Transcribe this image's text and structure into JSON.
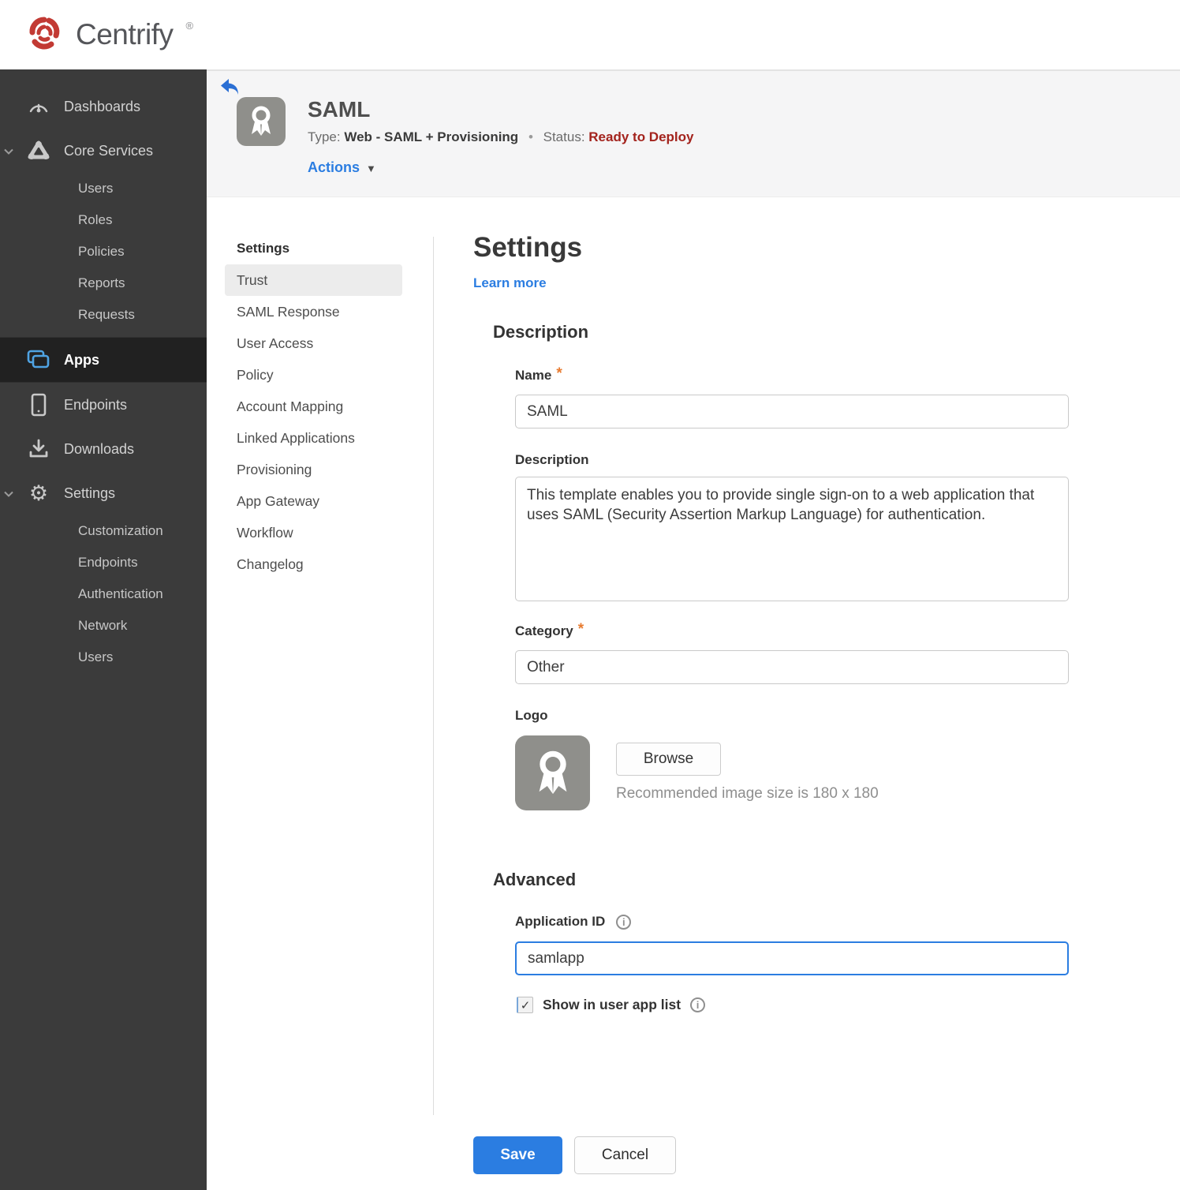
{
  "colors": {
    "accent_blue": "#2b7de1",
    "status_red": "#a3231d",
    "required_orange": "#e87b30",
    "brand_red": "#c23a34",
    "sidebar_bg": "#3b3b3b",
    "selected_row_bg": "#212121",
    "header_bg": "#f5f5f6"
  },
  "icons": {
    "brand": "centrify-swirl-icon",
    "dashboards": "gauge-icon",
    "core_services": "cluster-icon",
    "apps": "overlapping-windows-icon",
    "endpoints": "mobile-device-icon",
    "downloads": "download-icon",
    "settings": "gear-icon",
    "back": "back-arrow-icon",
    "app_logo": "award-ribbon-icon",
    "info": "info-circle-icon",
    "caret": "chevron-down-icon"
  },
  "topbar": {
    "brand": "Centrify",
    "brand_mark": "®"
  },
  "sidebar": {
    "dashboards": "Dashboards",
    "core_services": "Core Services",
    "core_children": [
      "Users",
      "Roles",
      "Policies",
      "Reports",
      "Requests"
    ],
    "apps": "Apps",
    "endpoints": "Endpoints",
    "downloads": "Downloads",
    "settings": "Settings",
    "settings_children": [
      "Customization",
      "Endpoints",
      "Authentication",
      "Network",
      "Users"
    ],
    "selected": "Apps"
  },
  "app_header": {
    "title": "SAML",
    "type_label": "Type:",
    "type_value": "Web - SAML + Provisioning",
    "separator": "•",
    "status_label": "Status:",
    "status_value": "Ready to Deploy",
    "actions_label": "Actions",
    "actions_caret": "▼"
  },
  "subnav": {
    "header": "Settings",
    "items": [
      "Trust",
      "SAML Response",
      "User Access",
      "Policy",
      "Account Mapping",
      "Linked Applications",
      "Provisioning",
      "App Gateway",
      "Workflow",
      "Changelog"
    ],
    "selected": "Trust"
  },
  "form": {
    "title": "Settings",
    "learn_more": "Learn more",
    "description_section": "Description",
    "name_label": "Name",
    "required_marker": "*",
    "name_value": "SAML",
    "description_label": "Description",
    "description_value": "This template enables you to provide single sign-on to a web application that uses SAML (Security Assertion Markup Language) for authentication.",
    "category_label": "Category",
    "category_value": "Other",
    "logo_label": "Logo",
    "browse_label": "Browse",
    "logo_hint": "Recommended image size is 180 x 180",
    "advanced_section": "Advanced",
    "app_id_label": "Application ID",
    "info_glyph": "i",
    "app_id_value": "samlapp",
    "show_in_app_list_label": "Show in user app list",
    "show_in_app_list_checked": "checked",
    "checkmark": "✓",
    "save_label": "Save",
    "cancel_label": "Cancel"
  }
}
